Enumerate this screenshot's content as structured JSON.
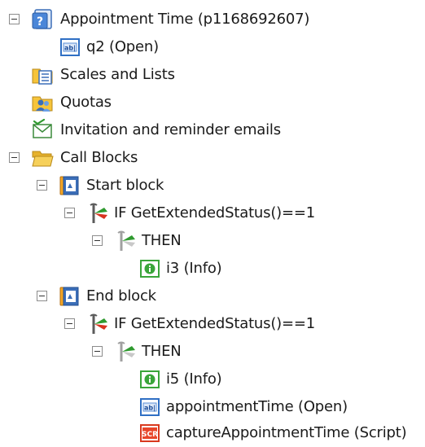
{
  "tree": {
    "nodes": [
      {
        "label": "Appointment Time (p1168692607)",
        "icon": "project-info-icon"
      },
      {
        "label": "q2 (Open)",
        "icon": "open-question-icon"
      },
      {
        "label": "Scales and Lists",
        "icon": "scales-lists-folder-icon"
      },
      {
        "label": "Quotas",
        "icon": "quotas-folder-icon"
      },
      {
        "label": "Invitation and reminder emails",
        "icon": "email-envelope-icon"
      },
      {
        "label": "Call Blocks",
        "icon": "open-folder-icon"
      },
      {
        "label": "Start block",
        "icon": "block-book-icon"
      },
      {
        "label": "IF GetExtendedStatus()==1",
        "icon": "if-condition-icon"
      },
      {
        "label": "THEN",
        "icon": "then-branch-icon"
      },
      {
        "label": "i3 (Info)",
        "icon": "info-node-icon"
      },
      {
        "label": "End block",
        "icon": "block-book-icon"
      },
      {
        "label": "IF GetExtendedStatus()==1",
        "icon": "if-condition-icon"
      },
      {
        "label": "THEN",
        "icon": "then-branch-icon"
      },
      {
        "label": "i5 (Info)",
        "icon": "info-node-icon"
      },
      {
        "label": "appointmentTime (Open)",
        "icon": "open-question-icon"
      },
      {
        "label": "captureAppointmentTime (Script)",
        "icon": "script-node-icon"
      }
    ]
  },
  "colors": {
    "folder_yellow": "#f6c43a",
    "info_green": "#3aa53a",
    "open_blue": "#2f6fc4",
    "script_red": "#d93a1f",
    "if_red": "#d8321f",
    "then_gray": "#8a8a8a"
  }
}
